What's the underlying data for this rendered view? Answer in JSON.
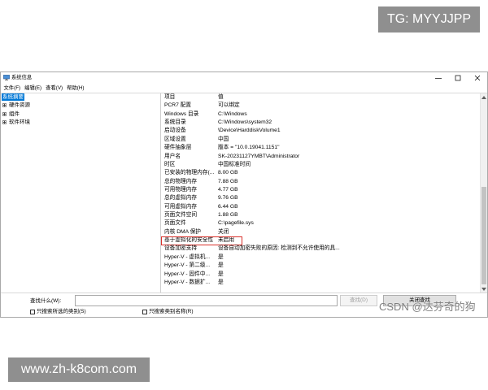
{
  "watermarks": {
    "top_right": "TG: MYYJJPP",
    "bottom_left": "www.zh-k8com.com",
    "csdn": "CSDN @达芬奇的狗"
  },
  "window": {
    "title": "系统信息"
  },
  "menu": {
    "items": [
      "文件(F)",
      "编辑(E)",
      "查看(V)",
      "帮助(H)"
    ]
  },
  "tree": {
    "items": [
      {
        "label": "系统摘要",
        "selected": true,
        "expandable": false
      },
      {
        "label": "硬件资源",
        "selected": false,
        "expandable": true
      },
      {
        "label": "组件",
        "selected": false,
        "expandable": true
      },
      {
        "label": "软件环境",
        "selected": false,
        "expandable": true
      }
    ]
  },
  "table": {
    "headers": [
      "项目",
      "值"
    ],
    "rows": [
      {
        "item": "PCR7 配置",
        "value": "可以绑定"
      },
      {
        "item": "Windows 目录",
        "value": "C:\\Windows"
      },
      {
        "item": "系统目录",
        "value": "C:\\Windows\\system32"
      },
      {
        "item": "启动设备",
        "value": "\\Device\\HarddiskVolume1"
      },
      {
        "item": "区域设置",
        "value": "中国"
      },
      {
        "item": "硬件抽象层",
        "value": "版本 = \"10.0.19041.1151\""
      },
      {
        "item": "用户名",
        "value": "SK-20231127YMBT\\Administrator"
      },
      {
        "item": "时区",
        "value": "中国标准时间"
      },
      {
        "item": "已安装的物理内存(...",
        "value": "8.00 GB"
      },
      {
        "item": "总的物理内存",
        "value": "7.88 GB"
      },
      {
        "item": "可用物理内存",
        "value": "4.77 GB"
      },
      {
        "item": "总的虚拟内存",
        "value": "9.76 GB"
      },
      {
        "item": "可用虚拟内存",
        "value": "6.44 GB"
      },
      {
        "item": "页面文件空间",
        "value": "1.88 GB"
      },
      {
        "item": "页面文件",
        "value": "C:\\pagefile.sys"
      },
      {
        "item": "内核 DMA 保护",
        "value": "关闭"
      },
      {
        "item": "基于虚拟化的安全性",
        "value": "未启用",
        "highlighted": true
      },
      {
        "item": "设备加密支持",
        "value": "设备自动加密失败的原因: 检测到不允许使用的具..."
      },
      {
        "item": "Hyper-V - 虚拟机...",
        "value": "是"
      },
      {
        "item": "Hyper-V - 第二级...",
        "value": "是"
      },
      {
        "item": "Hyper-V - 固件中...",
        "value": "是"
      },
      {
        "item": "Hyper-V - 数据扩...",
        "value": "是"
      }
    ]
  },
  "find": {
    "label": "查找什么(W):",
    "query": "",
    "find_button": "查找(D)",
    "find_button_enabled": false,
    "close_button": "关闭查找",
    "options": [
      {
        "label": "只搜索所选的类别(S)",
        "checked": false
      },
      {
        "label": "只搜索类别名称(R)",
        "checked": false
      }
    ]
  },
  "icons": {
    "app": "system-information-icon",
    "minimize": "minimize-icon",
    "maximize": "maximize-icon",
    "close": "close-icon",
    "expand": "expand-icon",
    "scroll_up": "scroll-up-icon",
    "scroll_down": "scroll-down-icon"
  },
  "colors": {
    "selection": "#0078d7",
    "annotation_box": "#d9312b",
    "watermark_box": "#8f8f8f"
  }
}
